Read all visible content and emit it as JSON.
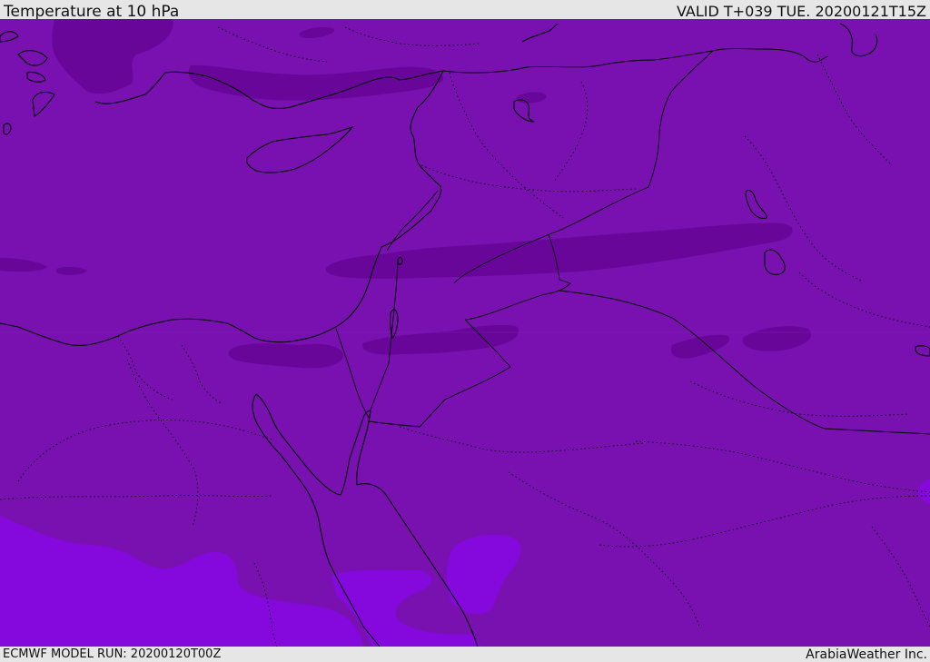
{
  "header": {
    "title": "Temperature at 10 hPa",
    "valid": "VALID T+039 TUE. 20200121T15Z"
  },
  "footer": {
    "model_run": "ECMWF MODEL RUN: 20200120T00Z",
    "credit": "ArabiaWeather Inc."
  },
  "colors": {
    "base_field": "#7811b0",
    "cold_band": "#68069a",
    "warm_zone": "#8508dc",
    "coastline": "#000000"
  }
}
